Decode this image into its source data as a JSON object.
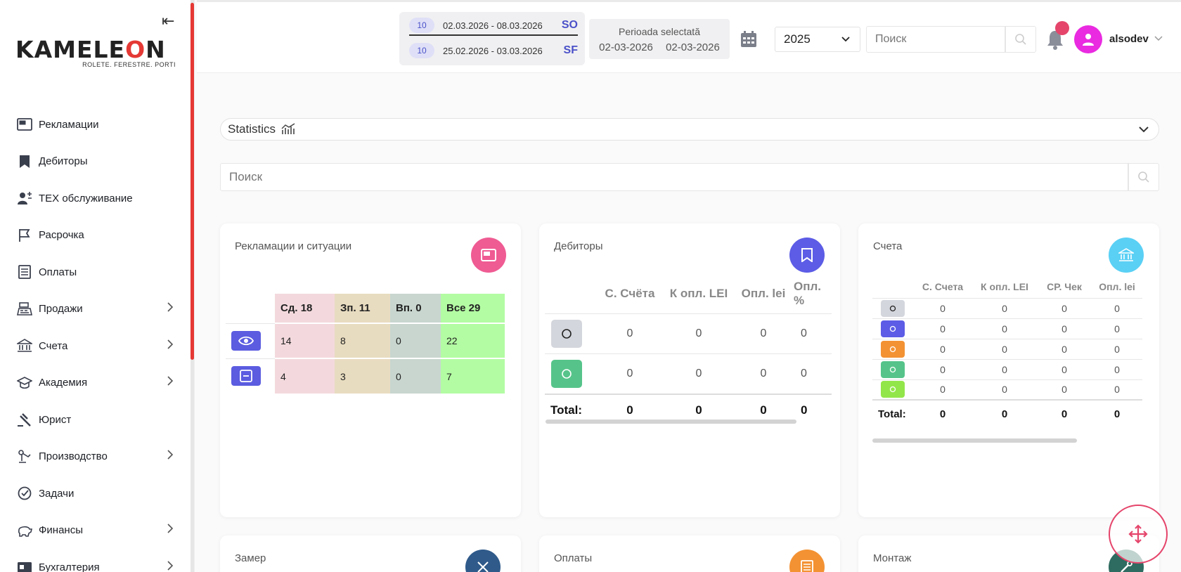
{
  "sidebar": {
    "logo_word_prefix": "KAMELE",
    "logo_word_o": "O",
    "logo_word_suffix": "N",
    "logo_tagline": "ROLETE. FERESTRE. PORTI",
    "collapse_glyph": "⇤",
    "items": [
      {
        "label": "Рекламации",
        "icon": "window-icon",
        "has_submenu": false
      },
      {
        "label": "Дебиторы",
        "icon": "bookmark-icon",
        "has_submenu": false
      },
      {
        "label": "ТЕХ обслуживание",
        "icon": "worker-icon",
        "has_submenu": false
      },
      {
        "label": "Расрочка",
        "icon": "flag-icon",
        "has_submenu": false
      },
      {
        "label": "Оплаты",
        "icon": "list-icon",
        "has_submenu": false
      },
      {
        "label": "Продажи",
        "icon": "cash-register-icon",
        "has_submenu": true
      },
      {
        "label": "Счета",
        "icon": "bank-icon",
        "has_submenu": true
      },
      {
        "label": "Академия",
        "icon": "graduation-cap-icon",
        "has_submenu": true
      },
      {
        "label": "Юрист",
        "icon": "gavel-icon",
        "has_submenu": false
      },
      {
        "label": "Производство",
        "icon": "robot-arm-icon",
        "has_submenu": true
      },
      {
        "label": "Задачи",
        "icon": "check-circle-icon",
        "has_submenu": false
      },
      {
        "label": "Финансы",
        "icon": "piggy-bank-icon",
        "has_submenu": true
      },
      {
        "label": "Бухгалтерия",
        "icon": "accounting-icon",
        "has_submenu": true
      }
    ]
  },
  "header": {
    "periods": [
      {
        "badge": "10",
        "range": "02.03.2026 - 08.03.2026",
        "code": "SO"
      },
      {
        "badge": "10",
        "range": "25.02.2026 - 03.03.2026",
        "code": "SF"
      }
    ],
    "selected_title": "Perioada selectată",
    "selected_from": "02-03-2026",
    "selected_to": "02-03-2026",
    "year": "2025",
    "search_placeholder": "Поиск",
    "username": "alsodev"
  },
  "main": {
    "stats_label": "Statistics",
    "search_placeholder": "Поиск",
    "reclamatii": {
      "title": "Рекламации и ситуации",
      "icon_color": "#ef5b93",
      "headers": [
        "Сд. 18",
        "Зп. 11",
        "Вп. 0",
        "Все 29"
      ],
      "rows": [
        {
          "icon": "eye-icon",
          "values": [
            "14",
            "8",
            "0",
            "22"
          ]
        },
        {
          "icon": "minus-square-icon",
          "values": [
            "4",
            "3",
            "0",
            "7"
          ]
        }
      ]
    },
    "debitori": {
      "title": "Дебиторы",
      "icon_color": "#5c5ce6",
      "headers": [
        "С. Счёта",
        "К опл. LEI",
        "Опл. lei",
        "Опл. %"
      ],
      "rows": [
        {
          "color": "#d4d6dd",
          "values": [
            "0",
            "0",
            "0",
            "0"
          ]
        },
        {
          "color": "#56c48a",
          "values": [
            "0",
            "0",
            "0",
            "0"
          ]
        }
      ],
      "total_label": "Total:",
      "totals": [
        "0",
        "0",
        "0",
        "0"
      ]
    },
    "scheta": {
      "title": "Счета",
      "icon_color": "#5ad0f5",
      "headers": [
        "С. Счета",
        "К опл. LEI",
        "СР. Чек",
        "Опл. lei"
      ],
      "rows": [
        {
          "color": "#d4d6dd",
          "values": [
            "0",
            "0",
            "0",
            "0"
          ]
        },
        {
          "color": "#5c5ce6",
          "values": [
            "0",
            "0",
            "0",
            "0"
          ]
        },
        {
          "color": "#f39233",
          "values": [
            "0",
            "0",
            "0",
            "0"
          ]
        },
        {
          "color": "#56c48a",
          "values": [
            "0",
            "0",
            "0",
            "0"
          ]
        },
        {
          "color": "#93e64a",
          "values": [
            "0",
            "0",
            "0",
            "0"
          ]
        }
      ],
      "total_label": "Total:",
      "totals": [
        "0",
        "0",
        "0",
        "0"
      ]
    },
    "bottom_cards": [
      {
        "title": "Замер",
        "icon_color": "#2f5a8a"
      },
      {
        "title": "Оплаты",
        "icon_color": "#f39233"
      },
      {
        "title": "Монтаж",
        "icon_color": "#2e6b60"
      }
    ]
  }
}
